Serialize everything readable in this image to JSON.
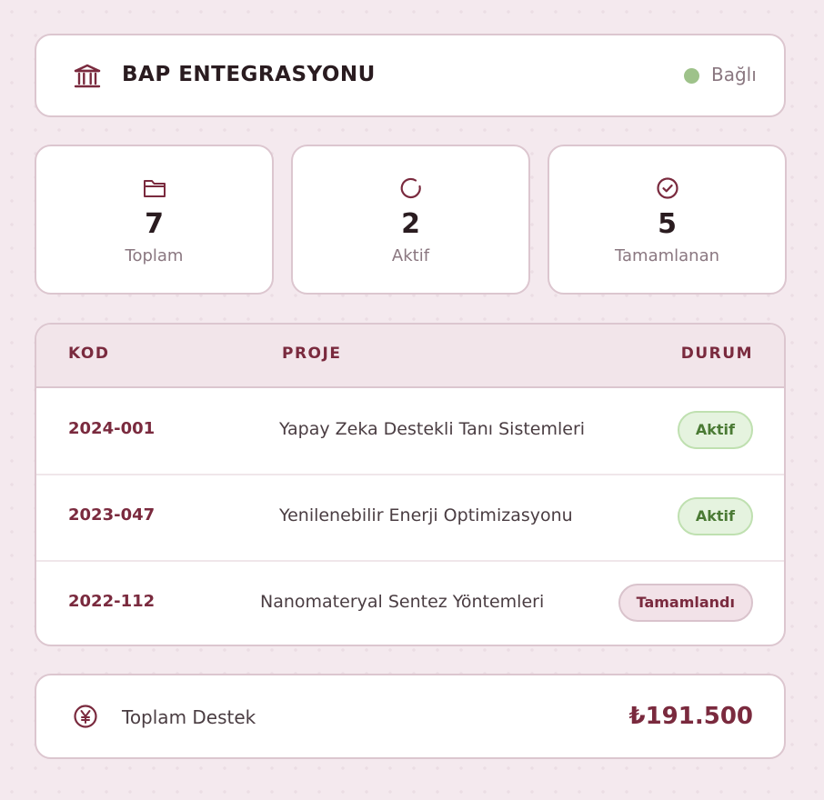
{
  "header": {
    "title": "BAP ENTEGRASYONU",
    "status": "Bağlı",
    "status_color": "#9ec28a"
  },
  "stats": [
    {
      "icon": "folder-icon",
      "value": "7",
      "label": "Toplam"
    },
    {
      "icon": "refresh-icon",
      "value": "2",
      "label": "Aktif"
    },
    {
      "icon": "check-circle-icon",
      "value": "5",
      "label": "Tamamlanan"
    }
  ],
  "table": {
    "headers": {
      "code": "KOD",
      "project": "PROJE",
      "status": "DURUM"
    },
    "rows": [
      {
        "code": "2024-001",
        "project": "Yapay Zeka Destekli Tanı Sistemleri",
        "status": "Aktif"
      },
      {
        "code": "2023-047",
        "project": "Yenilenebilir Enerji Optimizasyonu",
        "status": "Aktif"
      },
      {
        "code": "2022-112",
        "project": "Nanomateryal Sentez Yöntemleri",
        "status": "Tamamlandı"
      }
    ]
  },
  "total": {
    "icon": "yen-icon",
    "label": "Toplam Destek",
    "amount": "₺191.500"
  },
  "colors": {
    "accent": "#7a2a3e",
    "active_badge": "#e5f3df",
    "done_badge": "#f2e2e8"
  }
}
